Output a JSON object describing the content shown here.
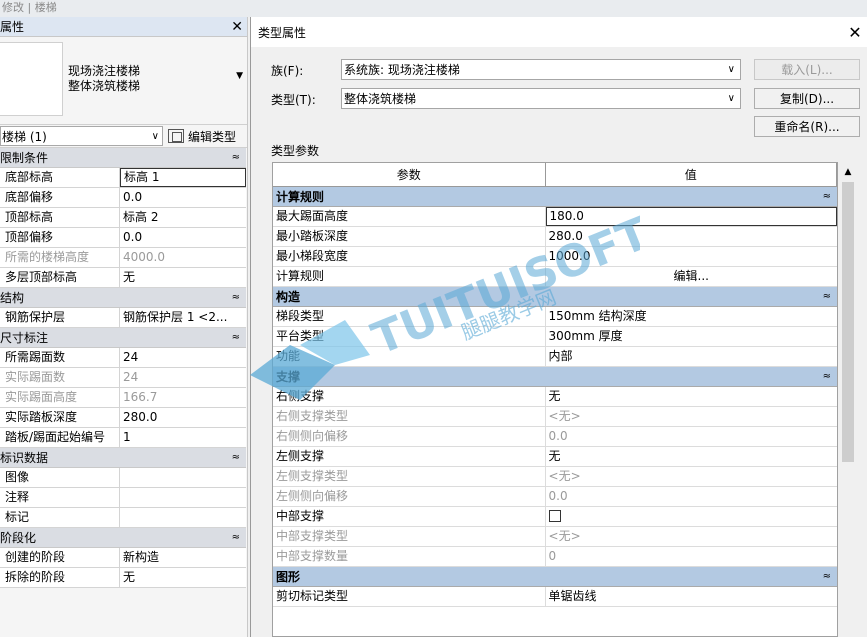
{
  "ribbon": {
    "text": "修改 | 楼梯"
  },
  "properties": {
    "title": "属性",
    "close": "✕",
    "type_name_line1": "现场浇注楼梯",
    "type_name_line2": "整体浇筑楼梯",
    "instance_filter": "楼梯 (1)",
    "edit_type_label": "编辑类型",
    "sections": [
      {
        "name": "限制条件",
        "rows": [
          {
            "k": "底部标高",
            "v": "标高 1",
            "sel": true
          },
          {
            "k": "底部偏移",
            "v": "0.0"
          },
          {
            "k": "顶部标高",
            "v": "标高 2"
          },
          {
            "k": "顶部偏移",
            "v": "0.0"
          },
          {
            "k": "所需的楼梯高度",
            "v": "4000.0",
            "dis": true
          },
          {
            "k": "多层顶部标高",
            "v": "无"
          }
        ]
      },
      {
        "name": "结构",
        "rows": [
          {
            "k": "钢筋保护层",
            "v": "钢筋保护层 1 <2..."
          }
        ]
      },
      {
        "name": "尺寸标注",
        "rows": [
          {
            "k": "所需踢面数",
            "v": "24"
          },
          {
            "k": "实际踢面数",
            "v": "24",
            "dis": true
          },
          {
            "k": "实际踢面高度",
            "v": "166.7",
            "dis": true
          },
          {
            "k": "实际踏板深度",
            "v": "280.0"
          },
          {
            "k": "踏板/踢面起始编号",
            "v": "1"
          }
        ]
      },
      {
        "name": "标识数据",
        "rows": [
          {
            "k": "图像",
            "v": ""
          },
          {
            "k": "注释",
            "v": ""
          },
          {
            "k": "标记",
            "v": ""
          }
        ]
      },
      {
        "name": "阶段化",
        "rows": [
          {
            "k": "创建的阶段",
            "v": "新构造"
          },
          {
            "k": "拆除的阶段",
            "v": "无"
          }
        ]
      }
    ]
  },
  "dialog": {
    "title": "类型属性",
    "family_label": "族(F):",
    "family_value": "系统族: 现场浇注楼梯",
    "type_label": "类型(T):",
    "type_value": "整体浇筑楼梯",
    "load_button": "载入(L)...",
    "duplicate_button": "复制(D)...",
    "rename_button": "重命名(R)...",
    "type_params_label": "类型参数",
    "col_param": "参数",
    "col_value": "值",
    "sections": [
      {
        "name": "计算规则",
        "rows": [
          {
            "k": "最大踢面高度",
            "v": "180.0",
            "sel": true
          },
          {
            "k": "最小踏板深度",
            "v": "280.0"
          },
          {
            "k": "最小梯段宽度",
            "v": "1000.0"
          },
          {
            "k": "计算规则",
            "v": "编辑...",
            "center": true
          }
        ]
      },
      {
        "name": "构造",
        "rows": [
          {
            "k": "梯段类型",
            "v": "150mm 结构深度"
          },
          {
            "k": "平台类型",
            "v": "300mm 厚度"
          },
          {
            "k": "功能",
            "v": "内部"
          }
        ]
      },
      {
        "name": "支撑",
        "rows": [
          {
            "k": "右侧支撑",
            "v": "无"
          },
          {
            "k": "右侧支撑类型",
            "v": "<无>",
            "dis": true
          },
          {
            "k": "右侧侧向偏移",
            "v": "0.0",
            "dis": true
          },
          {
            "k": "左侧支撑",
            "v": "无"
          },
          {
            "k": "左侧支撑类型",
            "v": "<无>",
            "dis": true
          },
          {
            "k": "左侧侧向偏移",
            "v": "0.0",
            "dis": true
          },
          {
            "k": "中部支撑",
            "v": "",
            "checkbox": true
          },
          {
            "k": "中部支撑类型",
            "v": "<无>",
            "dis": true
          },
          {
            "k": "中部支撑数量",
            "v": "0",
            "dis": true
          }
        ]
      },
      {
        "name": "图形",
        "rows": [
          {
            "k": "剪切标记类型",
            "v": "单锯齿线"
          }
        ]
      }
    ],
    "collapse_glyph": "≈"
  },
  "watermark": {
    "brand": "TUITUISOFT",
    "sub": "腿腿教学网"
  },
  "colors": {
    "section_blue": "#b3c9e2",
    "watermark": "#5aa9d6"
  }
}
